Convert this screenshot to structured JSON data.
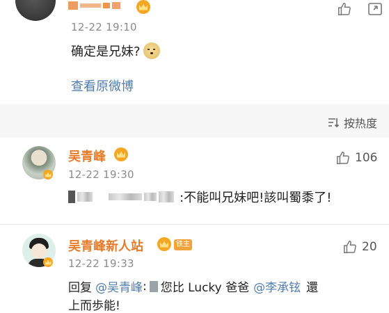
{
  "top_comment": {
    "username_masked": "F■■■■ ■ ■",
    "time": "12-22 19:10",
    "text": "确定是兄妹?",
    "emoji": "doge-emoji",
    "view_original": "查看原微博"
  },
  "sort": {
    "label": "按热度"
  },
  "comments": [
    {
      "username": "吴青峰",
      "time": "12-22 19:30",
      "likes": "106",
      "text": ":不能叫兄妹吧!該叫蜀黍了!"
    },
    {
      "username": "吴青峰新人站",
      "fan_badge": "铁主",
      "time": "12-22 19:33",
      "likes": "20",
      "reply_prefix": "回复",
      "mention1": "@吴青峰",
      "colon": ":",
      "text_mid": "您比 Lucky 爸爸",
      "mention2": "@李承铉",
      "text_end": "還",
      "text_cut": "上而歩能!"
    }
  ],
  "colors": {
    "username": "#e87b2a",
    "link": "#507daf",
    "muted": "#8c8c8c",
    "badge": "#f5a623"
  }
}
